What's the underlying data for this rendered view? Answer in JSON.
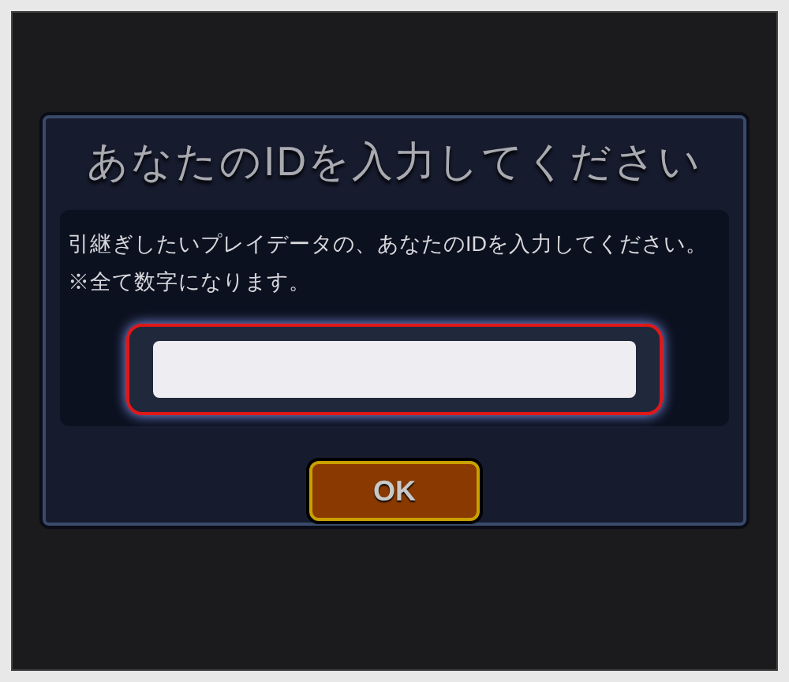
{
  "dialog": {
    "title": "あなたのIDを入力してください",
    "message_lines": [
      "引継ぎしたいプレイデータの、あなたのIDを入力してください。",
      "※全て数字になります。"
    ],
    "buttons": [
      "OK"
    ]
  }
}
